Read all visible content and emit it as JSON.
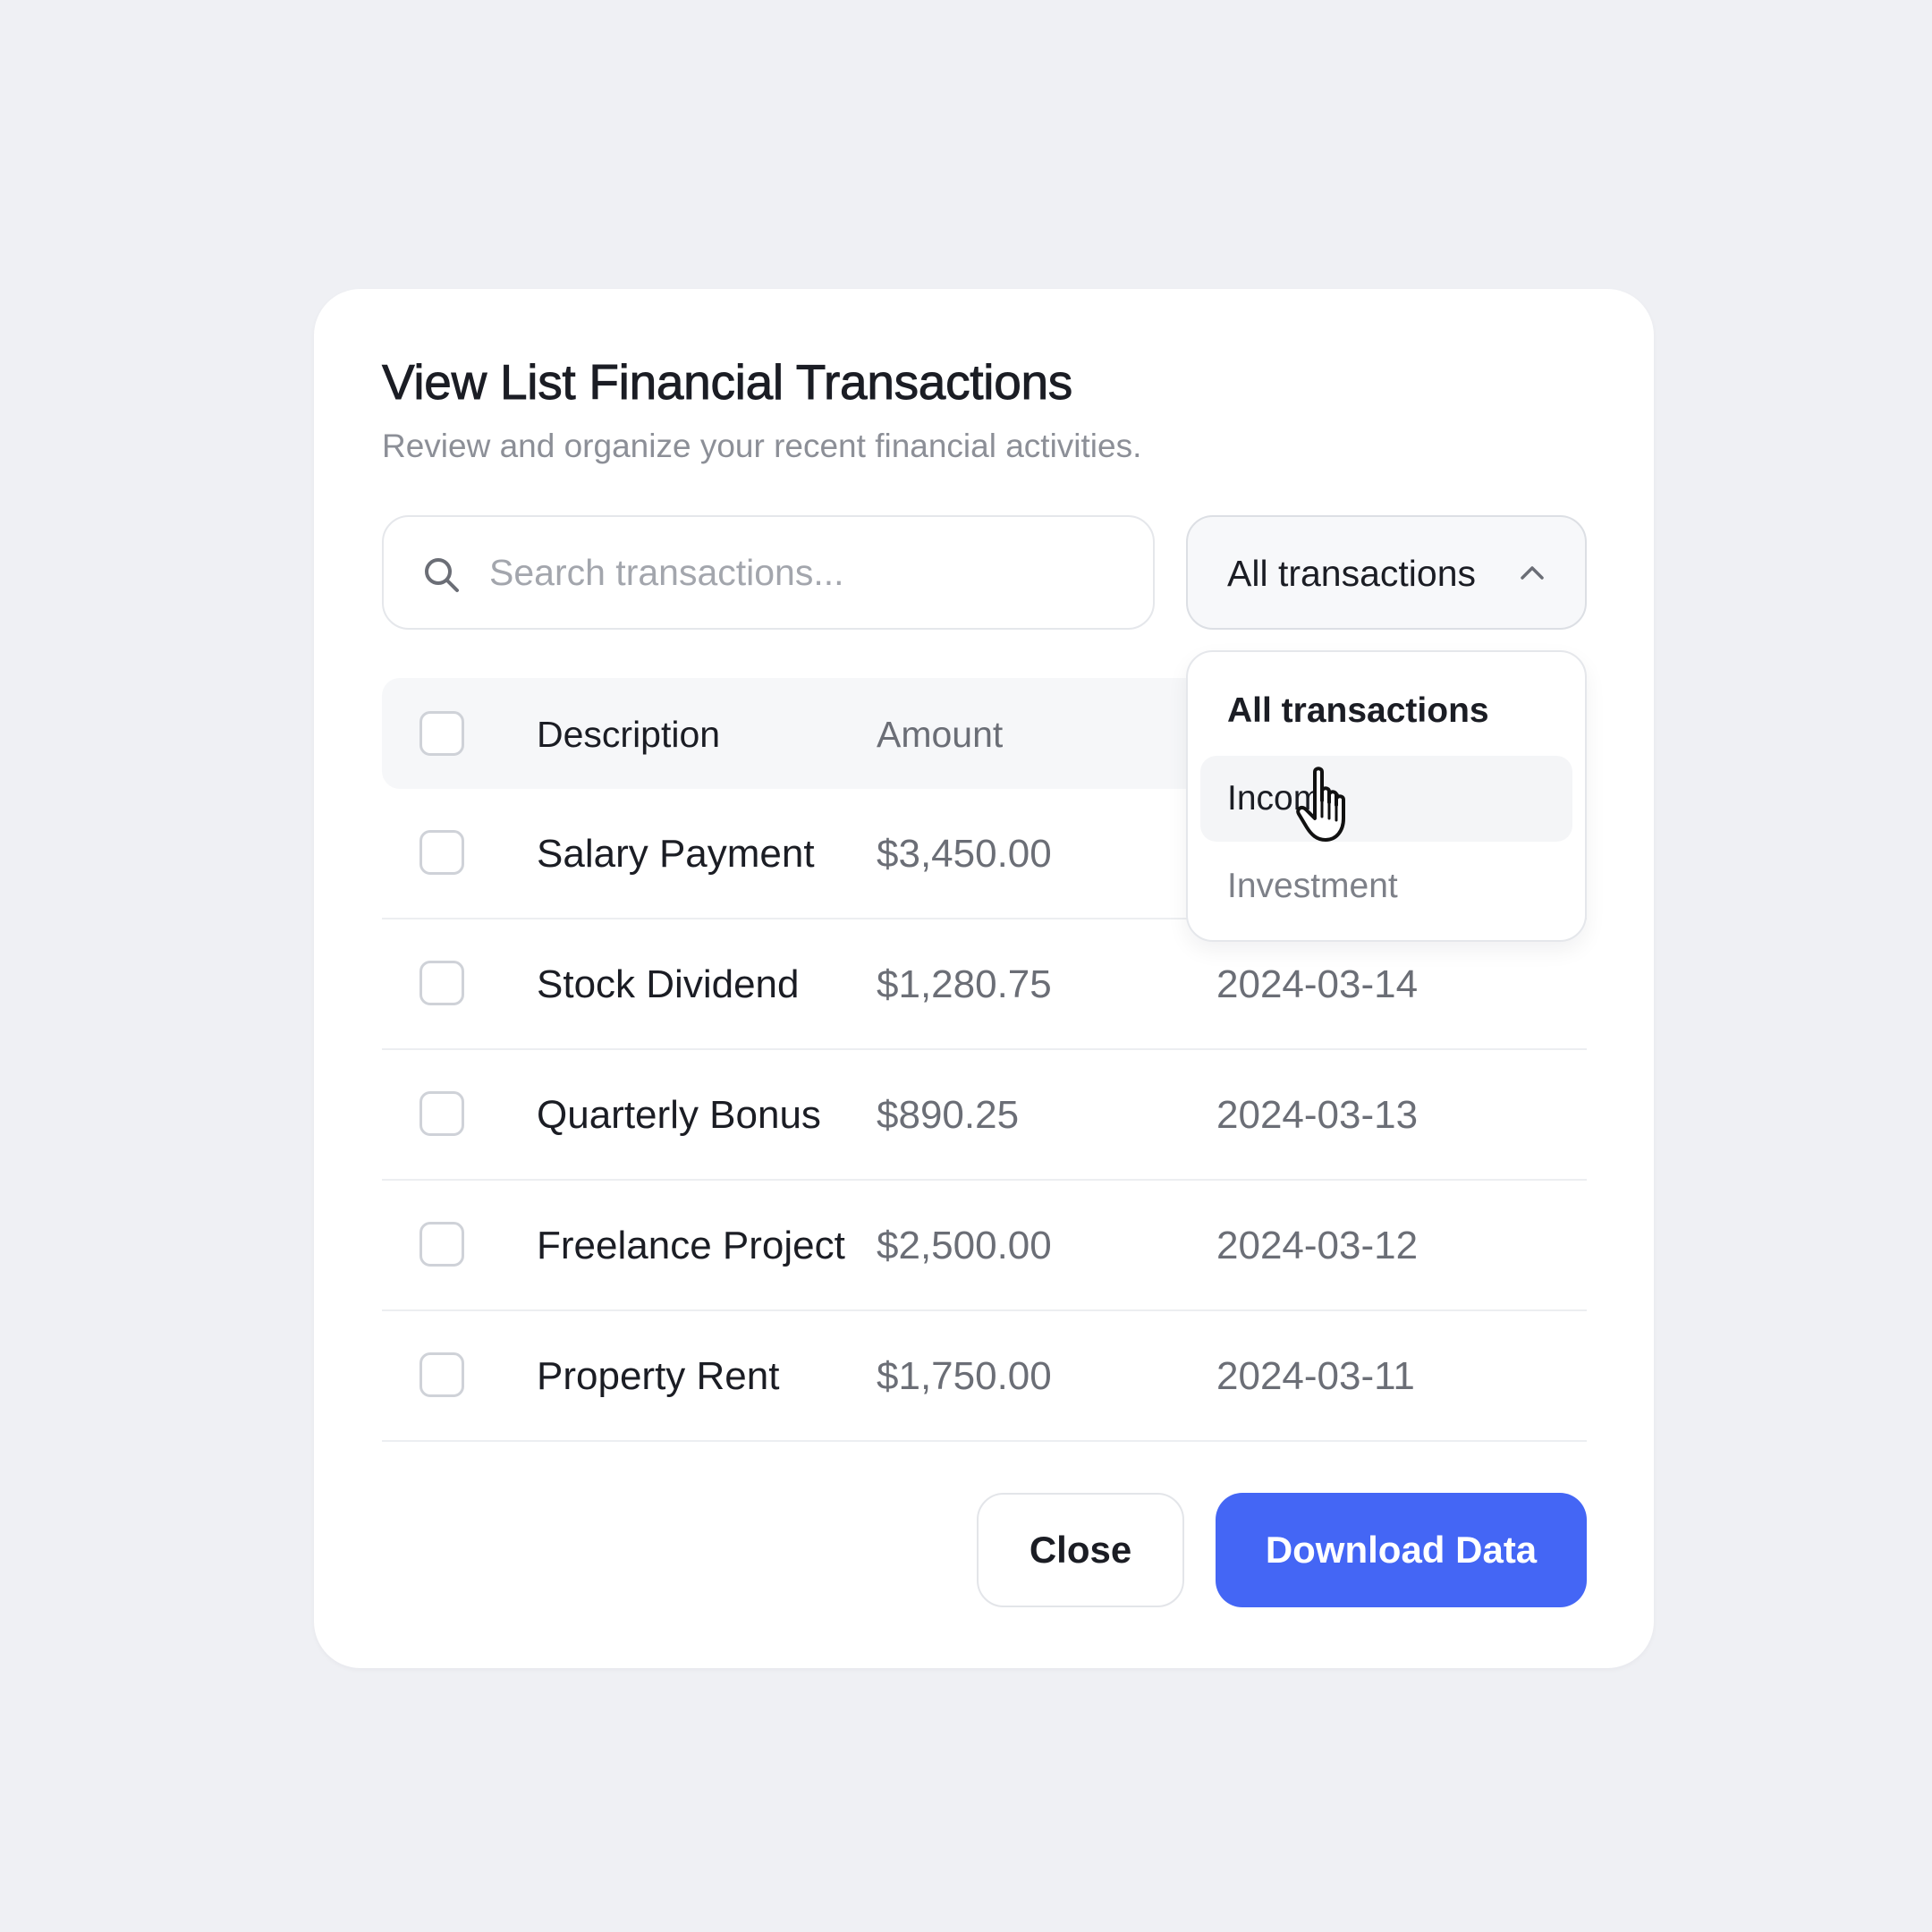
{
  "dialog": {
    "title": "View List Financial Transactions",
    "subtitle": "Review and organize your recent financial activities."
  },
  "search": {
    "placeholder": "Search transactions...",
    "value": "",
    "icon": "search-icon"
  },
  "filter": {
    "selected": "All transactions",
    "icon": "chevron-up-icon",
    "options": [
      "All transactions",
      "Income",
      "Investment"
    ],
    "hovered": "Income"
  },
  "table": {
    "headers": [
      "Description",
      "Amount"
    ],
    "rows": [
      {
        "description": "Salary Payment",
        "amount": "$3,450.00",
        "date": ""
      },
      {
        "description": "Stock Dividend",
        "amount": "$1,280.75",
        "date": "2024-03-14"
      },
      {
        "description": "Quarterly Bonus",
        "amount": "$890.25",
        "date": "2024-03-13"
      },
      {
        "description": "Freelance Project",
        "amount": "$2,500.00",
        "date": "2024-03-12"
      },
      {
        "description": "Property Rent",
        "amount": "$1,750.00",
        "date": "2024-03-11"
      }
    ]
  },
  "actions": {
    "close_label": "Close",
    "download_label": "Download Data"
  },
  "colors": {
    "accent": "#4466f5",
    "background": "#eff0f4",
    "card": "#ffffff"
  }
}
